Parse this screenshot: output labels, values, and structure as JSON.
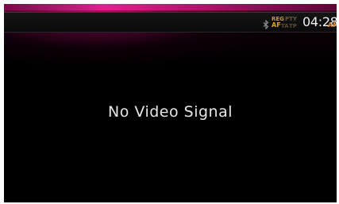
{
  "status_bar": {
    "bluetooth_icon": "bluetooth-icon",
    "radio_flags": {
      "reg": "REG",
      "pty": "PTY",
      "af": "AF",
      "ta": "TA",
      "tp": "TP"
    },
    "time": "04:28",
    "ampm": "AM"
  },
  "main": {
    "message": "No Video Signal"
  },
  "colors": {
    "accent": "#e0208e",
    "background": "#000000",
    "text": "#e6e6e6",
    "ampm": "#e08a2a"
  }
}
